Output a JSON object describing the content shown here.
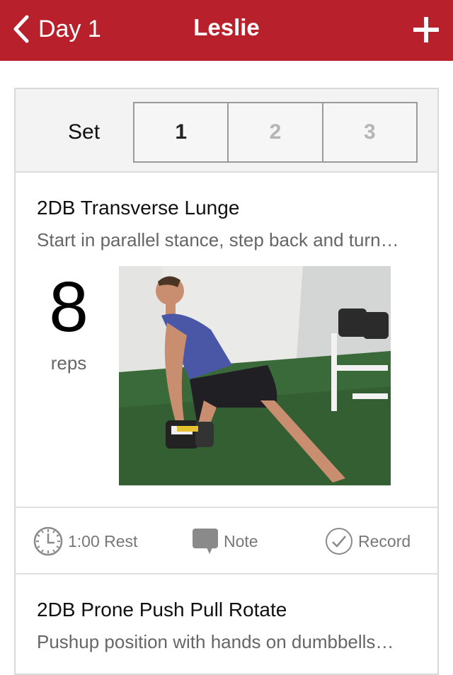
{
  "navbar": {
    "back_label": "Day 1",
    "title": "Leslie",
    "accent_color": "#b8202b",
    "icons": {
      "back": "chevron-left-icon",
      "add": "plus-icon"
    }
  },
  "set_selector": {
    "label": "Set",
    "options": [
      "1",
      "2",
      "3"
    ],
    "selected": "1"
  },
  "exercises": [
    {
      "title": "2DB Transverse Lunge",
      "description": "Start in parallel stance, step back and turn…",
      "reps_value": "8",
      "reps_unit": "reps"
    },
    {
      "title": "2DB Prone Push Pull Rotate",
      "description": "Pushup position with hands on dumbbells…"
    }
  ],
  "actions": {
    "rest": {
      "label": "1:00 Rest",
      "icon": "clock-icon"
    },
    "note": {
      "label": "Note",
      "icon": "speech-bubble-icon"
    },
    "record": {
      "label": "Record",
      "icon": "checkmark-circle-icon"
    }
  }
}
